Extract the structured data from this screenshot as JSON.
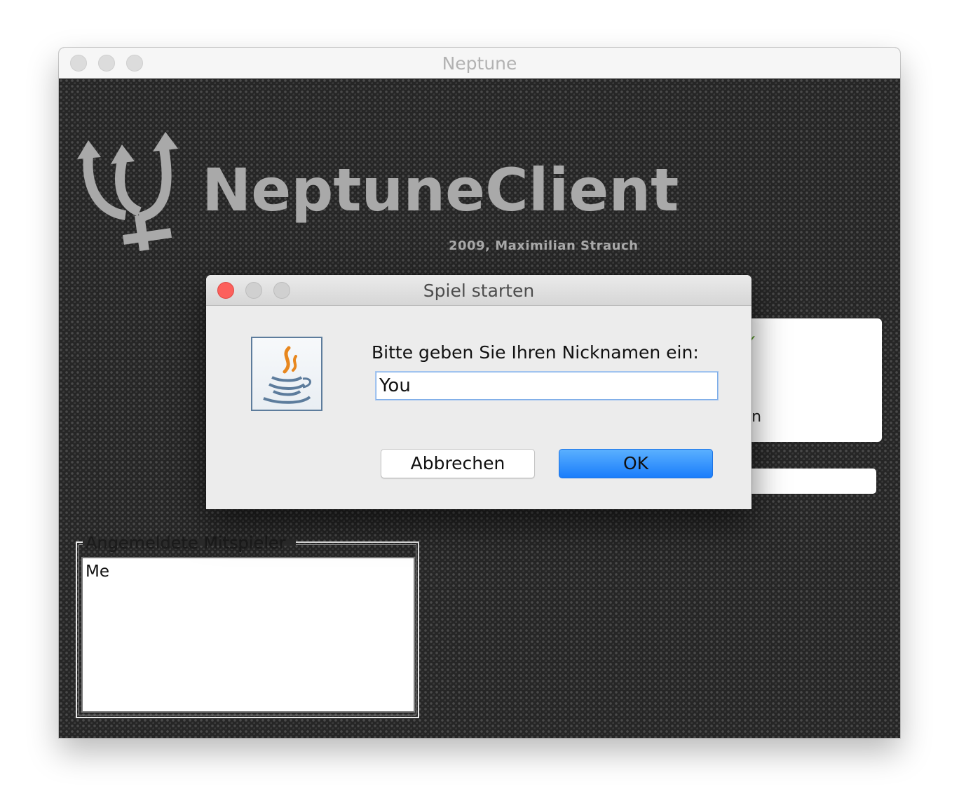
{
  "window": {
    "title": "Neptune"
  },
  "brand": {
    "name": "NeptuneClient",
    "credit": "2009, Maximilian Strauch"
  },
  "background_panel": {
    "card_text_fragment": "ten",
    "check_icon": "check-icon"
  },
  "players": {
    "legend": "Angemeldete Mitspieler",
    "items": [
      "Me"
    ]
  },
  "dialog": {
    "title": "Spiel starten",
    "icon": "java-icon",
    "prompt": "Bitte geben Sie Ihren Nicknamen ein:",
    "input_value": "You",
    "cancel_label": "Abbrechen",
    "ok_label": "OK"
  },
  "colors": {
    "accent": "#1a7dfb",
    "close": "#fc605c",
    "brand_gray": "#a9a9a9"
  }
}
